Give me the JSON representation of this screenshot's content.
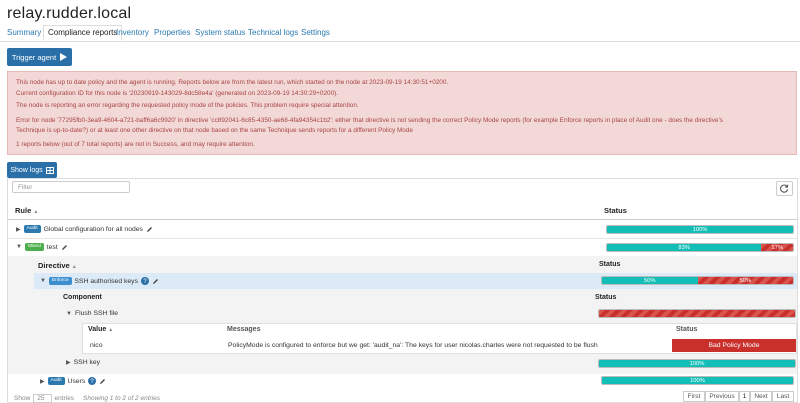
{
  "header": {
    "title": "relay.rudder.local"
  },
  "tabs": [
    "Summary",
    "Compliance reports",
    "Inventory",
    "Properties",
    "System status",
    "Technical logs",
    "Settings"
  ],
  "toolbar": {
    "trigger_label": "Trigger agent",
    "show_logs_label": "Show logs"
  },
  "alert": {
    "line1": "This node has up to date policy and the agent is running. Reports below are from the latest run, which started on the node at 2023-09-19 14:30:51+0200.",
    "line2": "Current configuration ID for this node is '20230919-143029-8dc58e4a' (generated on 2023-09-19 14:30:29+0200).",
    "line3": "The node is reporting an error regarding the requested policy mode of the policies. This problem require special attention.",
    "line4": "Error for node '77295fb0-3ea9-4604-a721-baff6a6c9920' in directive 'cc892041-6c85-4350-ae68-4fa94354c1b2': either that directive is not sending the correct Policy Mode reports (for example Enforce reports in place of Audit one - does the directive's",
    "line5": "Technique is up-to-date?) or at least one other directive on that node based on the same Technique sends reports for a different Policy Mode",
    "line6": "1 reports below (out of 7 total reports) are not in Success, and may require attention."
  },
  "filter": {
    "placeholder": "Filter"
  },
  "table": {
    "rule_header": "Rule",
    "status_header": "Status",
    "directive_header": "Directive",
    "component_header": "Component",
    "value_header": "Value",
    "messages_header": "Messages",
    "rules": [
      {
        "badge": "Audit",
        "name": "Global configuration for all nodes",
        "compliance": 100
      },
      {
        "badge": "Mixed",
        "name": "test",
        "compliance": 83,
        "error": 17
      }
    ],
    "directive": {
      "badge": "Enforce",
      "name": "SSH authorised keys",
      "compliance": 50,
      "error": 50
    },
    "components": [
      {
        "name": "Flush SSH file",
        "compliance": 0,
        "error": 100
      },
      {
        "name": "SSH key",
        "compliance": 100
      }
    ],
    "value_row": {
      "value": "nico",
      "message": "PolicyMode is configured to enforce but we get: 'audit_na': The keys for user nicolas.charles were not requested to be flush",
      "status": "Bad Policy Mode"
    },
    "last_rule": {
      "badge": "Audit",
      "name": "Users",
      "compliance": 100
    }
  },
  "footer": {
    "show_label": "Show",
    "page_size": "25",
    "entries_label": "entries",
    "info": "Showing 1 to 2 of 2 entries",
    "first": "First",
    "previous": "Previous",
    "page": "1",
    "next": "Next",
    "last": "Last"
  },
  "colors": {
    "success": "#13beb7",
    "error": "#d9534f",
    "primary": "#2a6fa8",
    "alert_bg": "#f2d9d8"
  }
}
